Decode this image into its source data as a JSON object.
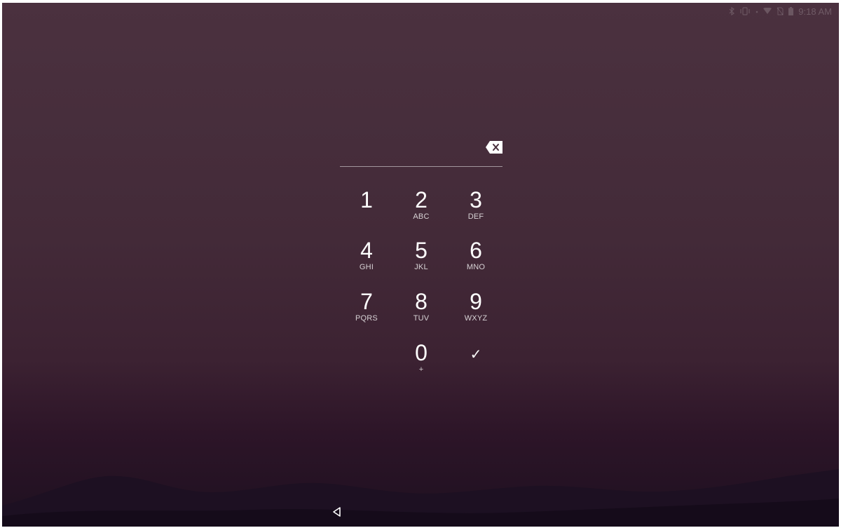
{
  "status_bar": {
    "time": "9:18 AM",
    "icons": [
      "bluetooth-icon",
      "vibrate-icon",
      "wifi-icon",
      "no-sim-icon",
      "battery-icon"
    ]
  },
  "pin_entry": {
    "value": "",
    "backspace_icon": "backspace-icon"
  },
  "keypad": {
    "keys": [
      {
        "digit": "1",
        "letters": ""
      },
      {
        "digit": "2",
        "letters": "ABC"
      },
      {
        "digit": "3",
        "letters": "DEF"
      },
      {
        "digit": "4",
        "letters": "GHI"
      },
      {
        "digit": "5",
        "letters": "JKL"
      },
      {
        "digit": "6",
        "letters": "MNO"
      },
      {
        "digit": "7",
        "letters": "PQRS"
      },
      {
        "digit": "8",
        "letters": "TUV"
      },
      {
        "digit": "9",
        "letters": "WXYZ"
      },
      {
        "digit": "0",
        "letters": "+"
      }
    ],
    "enter_symbol": "✓"
  },
  "nav_bar": {
    "back_icon": "back-triangle-icon"
  },
  "colors": {
    "wallpaper_top": "#4b313f",
    "wallpaper_bottom": "#1e1020"
  }
}
